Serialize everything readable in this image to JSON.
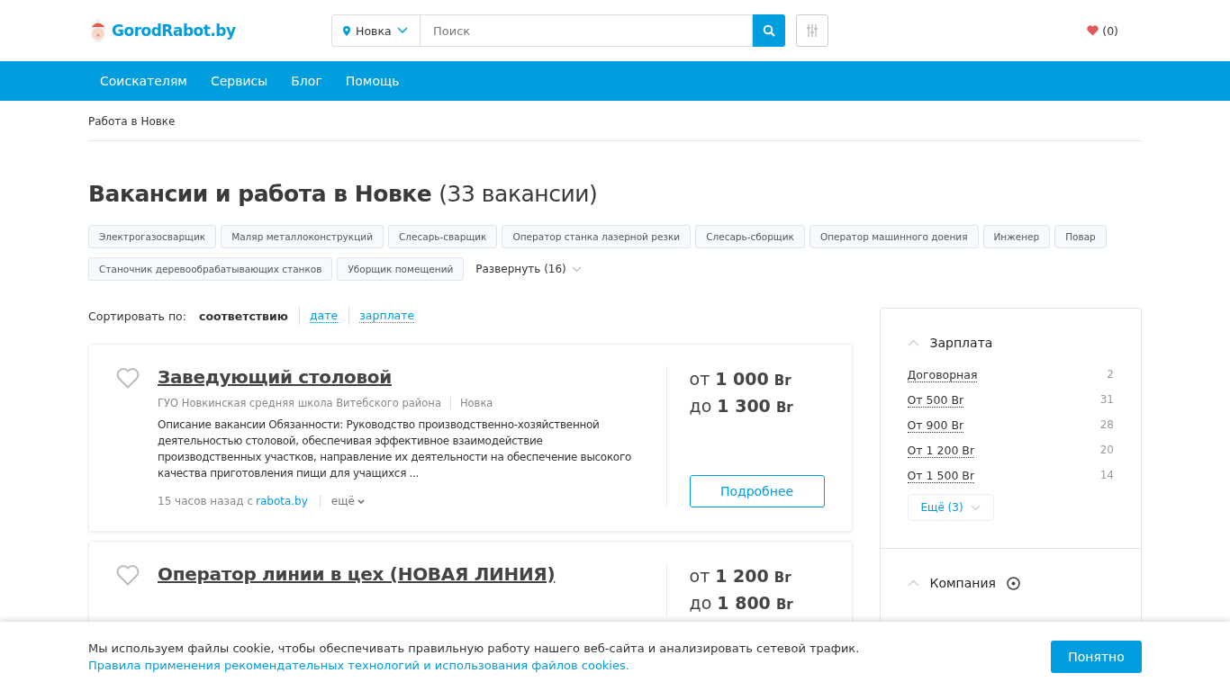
{
  "header": {
    "logo": "GorodRabot.by",
    "location": "Новка",
    "search": {
      "placeholder": "Поиск"
    },
    "favorites": "(0)"
  },
  "nav": [
    "Соискателям",
    "Сервисы",
    "Блог",
    "Помощь"
  ],
  "breadcrumb": "Работа в Новке",
  "heading": {
    "title": "Вакансии и работа в Новке",
    "count": "(33 вакансии)"
  },
  "tags": [
    "Электрогазосварщик",
    "Маляр металлоконструкций",
    "Слесарь-сварщик",
    "Оператор станка лазерной резки",
    "Слесарь-сборщик",
    "Оператор машинного доения",
    "Инженер",
    "Повар",
    "Станочник деревообрабатывающих станков",
    "Уборщик помещений"
  ],
  "expand_tags": "Развернуть (16)",
  "sort": {
    "label": "Сортировать по:",
    "options": [
      {
        "label": "соответствию",
        "selected": true
      },
      {
        "label": "дате",
        "selected": false
      },
      {
        "label": "зарплате",
        "selected": false
      }
    ]
  },
  "vacancies": [
    {
      "title": "Заведующий столовой",
      "company": "ГУО Новкинская средняя школа Витебского района",
      "city": "Новка",
      "description": "Описание вакансии Обязанности: Руководство производственно-хозяйственной деятельностью столовой, обеспечивая эффективное взаимодействие производственных участков, направление их деятельности на обеспечение высокого качества приготовления пищи для учащихся ...",
      "posted": "15 часов назад с",
      "source": "rabota.by",
      "more": "ещё",
      "salary_from_label": "от",
      "salary_from": "1 000",
      "currency_from": "Br",
      "salary_to_label": "до",
      "salary_to": "1 300",
      "currency_to": "Br",
      "button": "Подробнее"
    },
    {
      "title": "Оператор линии в цех (НОВАЯ ЛИНИЯ)",
      "salary_from_label": "от",
      "salary_from": "1 200",
      "currency_from": "Br",
      "salary_to_label": "до",
      "salary_to": "1 800",
      "currency_to": "Br"
    }
  ],
  "filters": [
    {
      "title": "Зарплата",
      "expanded": true,
      "options": [
        {
          "label": "Договорная",
          "count": "2"
        },
        {
          "label": "От 500 Br",
          "count": "31"
        },
        {
          "label": "От 900 Br",
          "count": "28"
        },
        {
          "label": "От 1 200 Br",
          "count": "20"
        },
        {
          "label": "От 1 500 Br",
          "count": "14"
        }
      ],
      "more": "Ещё (3)"
    },
    {
      "title": "Компания",
      "expanded": true
    }
  ],
  "cookie": {
    "text": "Мы используем файлы cookie, чтобы обеспечивать правильную работу нашего веб-сайта и анализировать сетевой трафик.",
    "link": "Правила применения рекомендательных технологий и использования файлов cookies.",
    "button": "Понятно"
  }
}
